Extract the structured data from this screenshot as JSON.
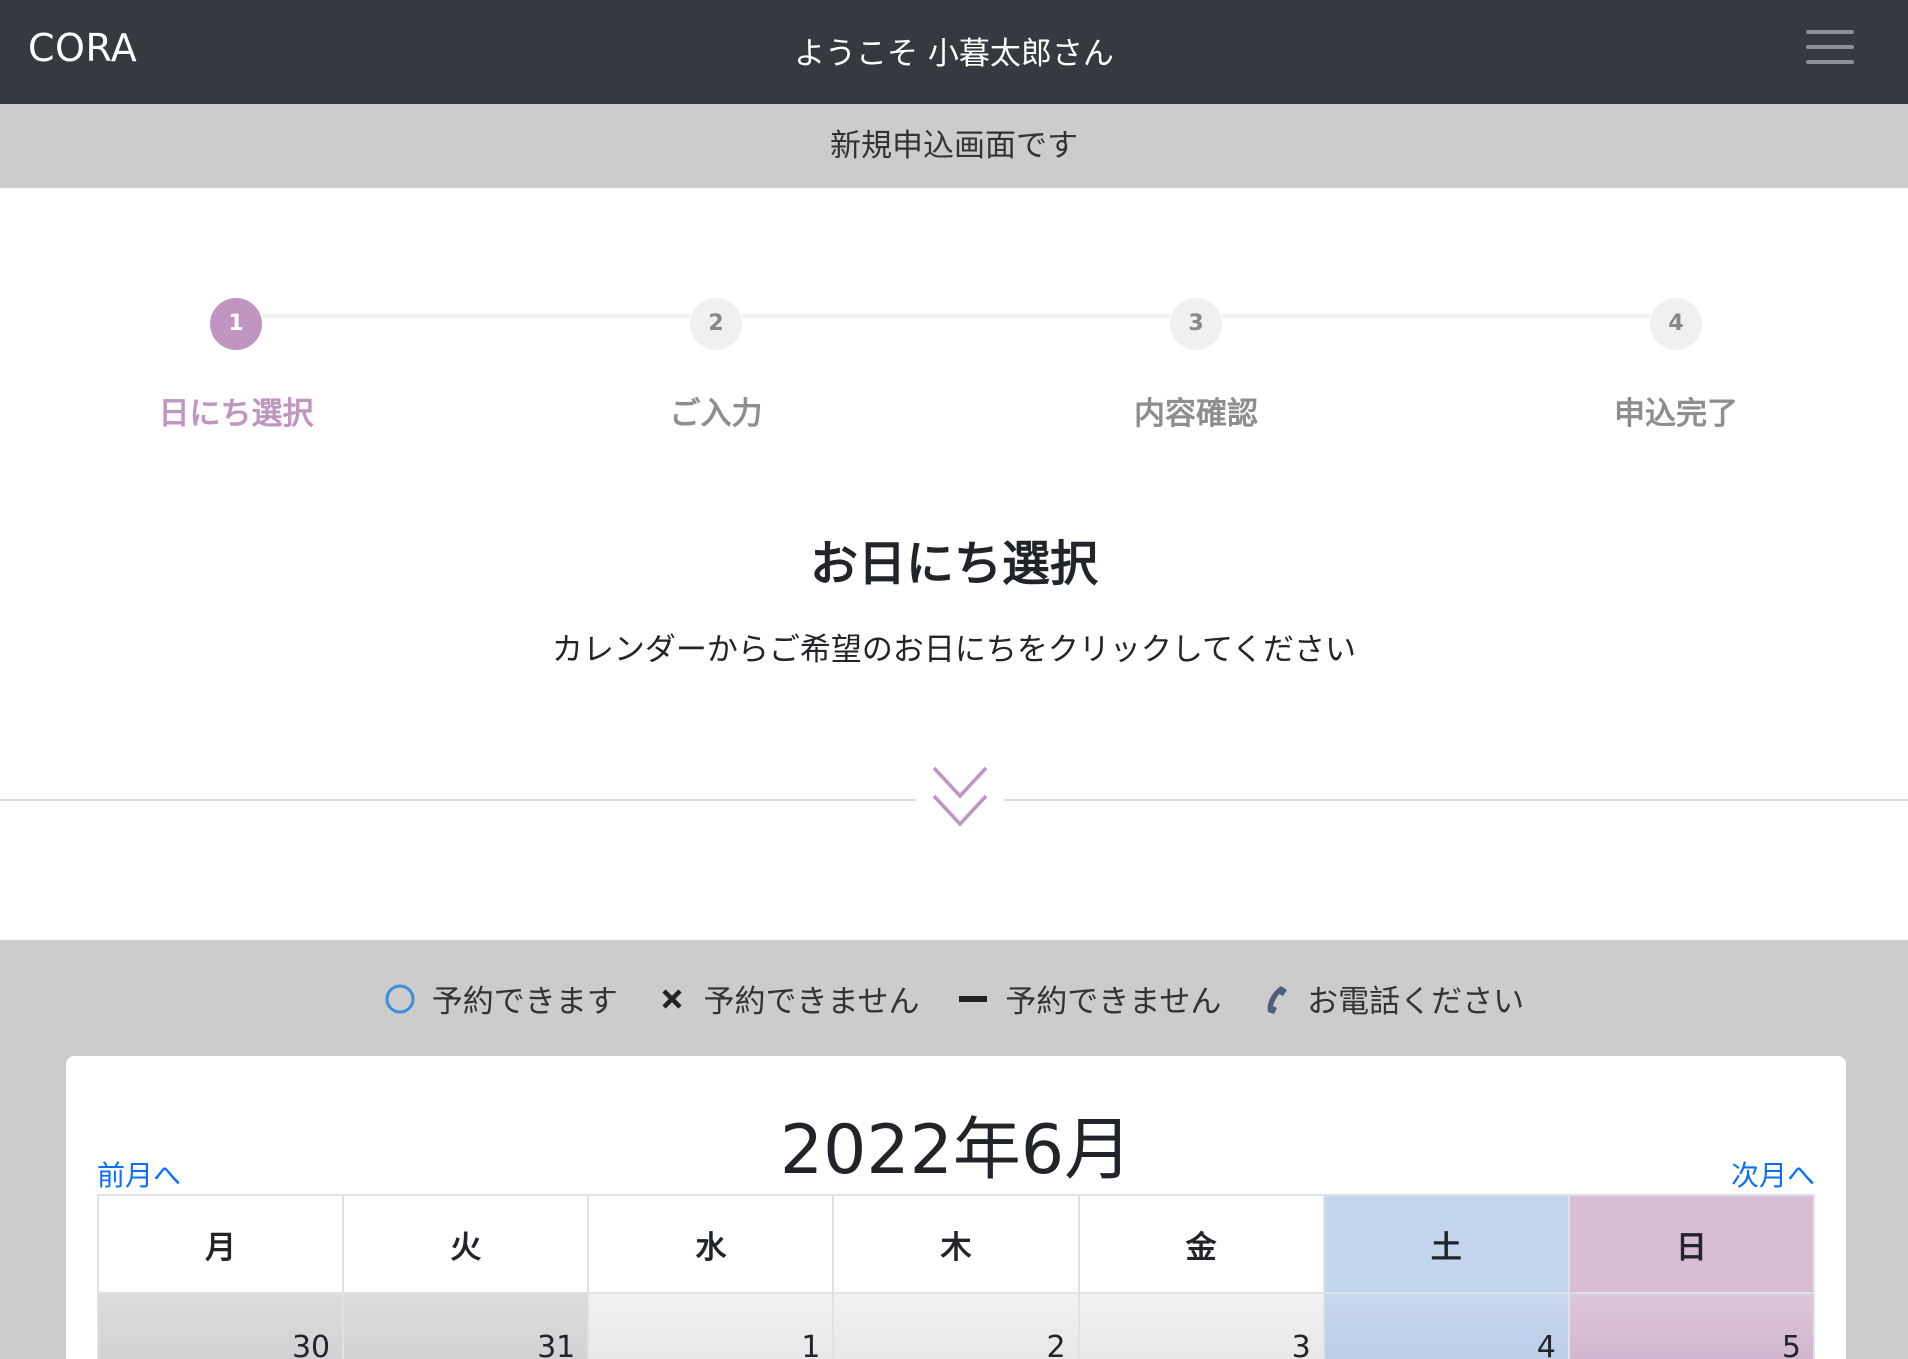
{
  "navbar": {
    "brand": "CORA",
    "welcome": "ようこそ 小暮太郎さん",
    "menu_icon": "hamburger-menu-icon"
  },
  "subheader": {
    "text": "新規申込画面です"
  },
  "stepper": {
    "active_step": 1,
    "steps": [
      {
        "number": "1",
        "label": "日にち選択"
      },
      {
        "number": "2",
        "label": "ご入力"
      },
      {
        "number": "3",
        "label": "内容確認"
      },
      {
        "number": "4",
        "label": "申込完了"
      }
    ]
  },
  "main": {
    "title": "お日にち選択",
    "instruction": "カレンダーからご希望のお日にちをクリックしてください",
    "divider_icon": "double-chevron-down-icon"
  },
  "legend": {
    "items": [
      {
        "icon": "circle-icon",
        "label": "予約できます"
      },
      {
        "icon": "cross-icon",
        "label": "予約できません"
      },
      {
        "icon": "dash-icon",
        "label": "予約できません"
      },
      {
        "icon": "phone-icon",
        "label": "お電話ください"
      }
    ]
  },
  "calendar": {
    "title": "2022年6月",
    "prev_label": "前月へ",
    "next_label": "次月へ",
    "weekdays": [
      "月",
      "火",
      "水",
      "木",
      "金",
      "土",
      "日"
    ],
    "first_row": [
      "30",
      "31",
      "1",
      "2",
      "3",
      "4",
      "5"
    ]
  },
  "colors": {
    "navbar": "#343a40",
    "subheader": "#cccccc",
    "accent": "#c095c2",
    "link": "#0d6efd",
    "saturday": "#c3d6ee",
    "sunday": "#d8bcd6"
  }
}
